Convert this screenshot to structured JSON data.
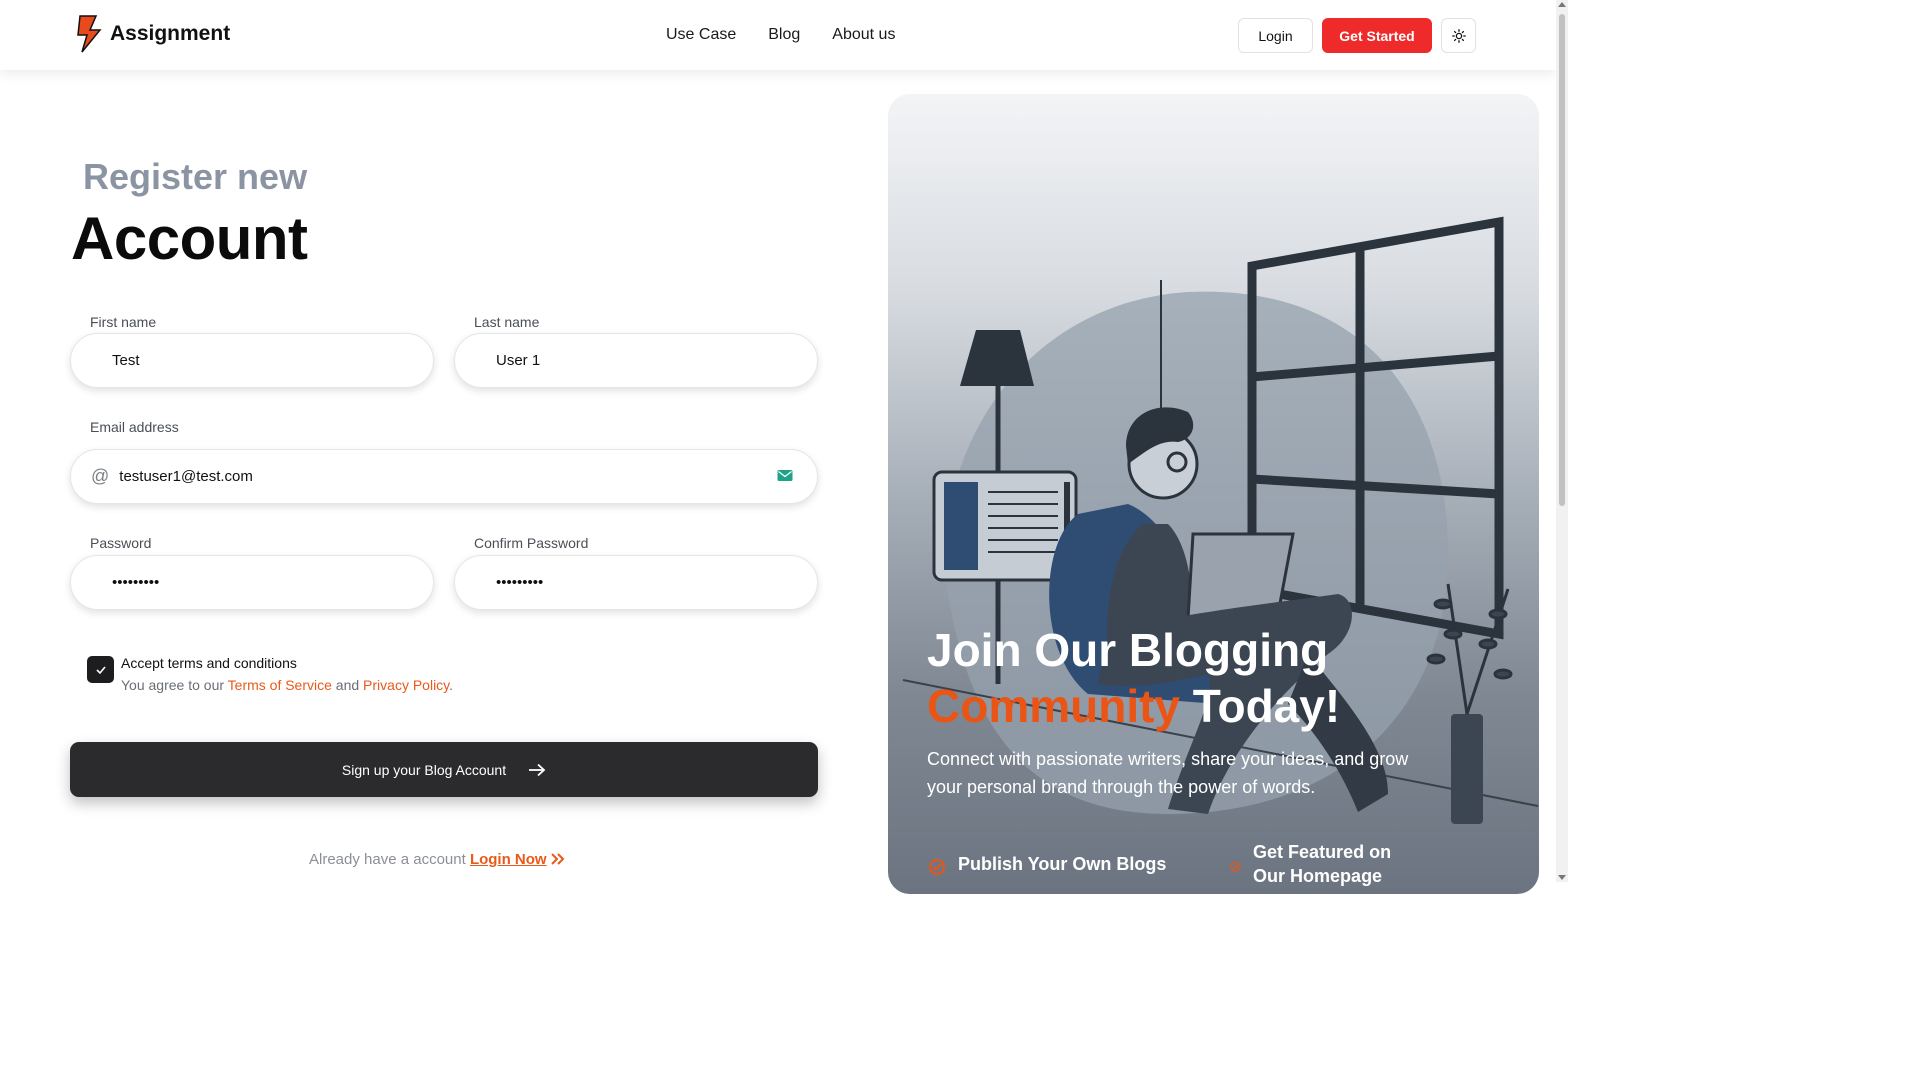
{
  "header": {
    "brand": "Assignment",
    "nav": [
      "Use Case",
      "Blog",
      "About us"
    ],
    "login_label": "Login",
    "get_started_label": "Get Started"
  },
  "form": {
    "title_sub": "Register new",
    "title_main": "Account",
    "first_name": {
      "label": "First name",
      "value": "Test"
    },
    "last_name": {
      "label": "Last name",
      "value": "User 1"
    },
    "email": {
      "label": "Email address",
      "value": "testuser1@test.com"
    },
    "password": {
      "label": "Password",
      "value": "•••••••••"
    },
    "confirm_password": {
      "label": "Confirm Password",
      "value": "•••••••••"
    },
    "terms": {
      "title": "Accept terms and conditions",
      "prefix": "You agree to our ",
      "tos": "Terms of Service",
      "and": " and ",
      "privacy": "Privacy Policy",
      "suffix": ".",
      "checked": true
    },
    "signup_label": "Sign up your Blog Account",
    "already_text": "Already have a account ",
    "login_now": "Login Now"
  },
  "panel": {
    "headline_1": "Join Our Blogging",
    "headline_orange": "Community",
    "headline_2": " Today!",
    "description": "Connect with passionate writers, share your ideas, and grow your personal brand through the power of words.",
    "features": [
      "Publish Your Own Blogs",
      "Get Featured on Our Homepage"
    ]
  },
  "colors": {
    "accent": "#ea5415",
    "primary_button": "#ee2a2a",
    "dark_button": "#2b2b2d"
  }
}
